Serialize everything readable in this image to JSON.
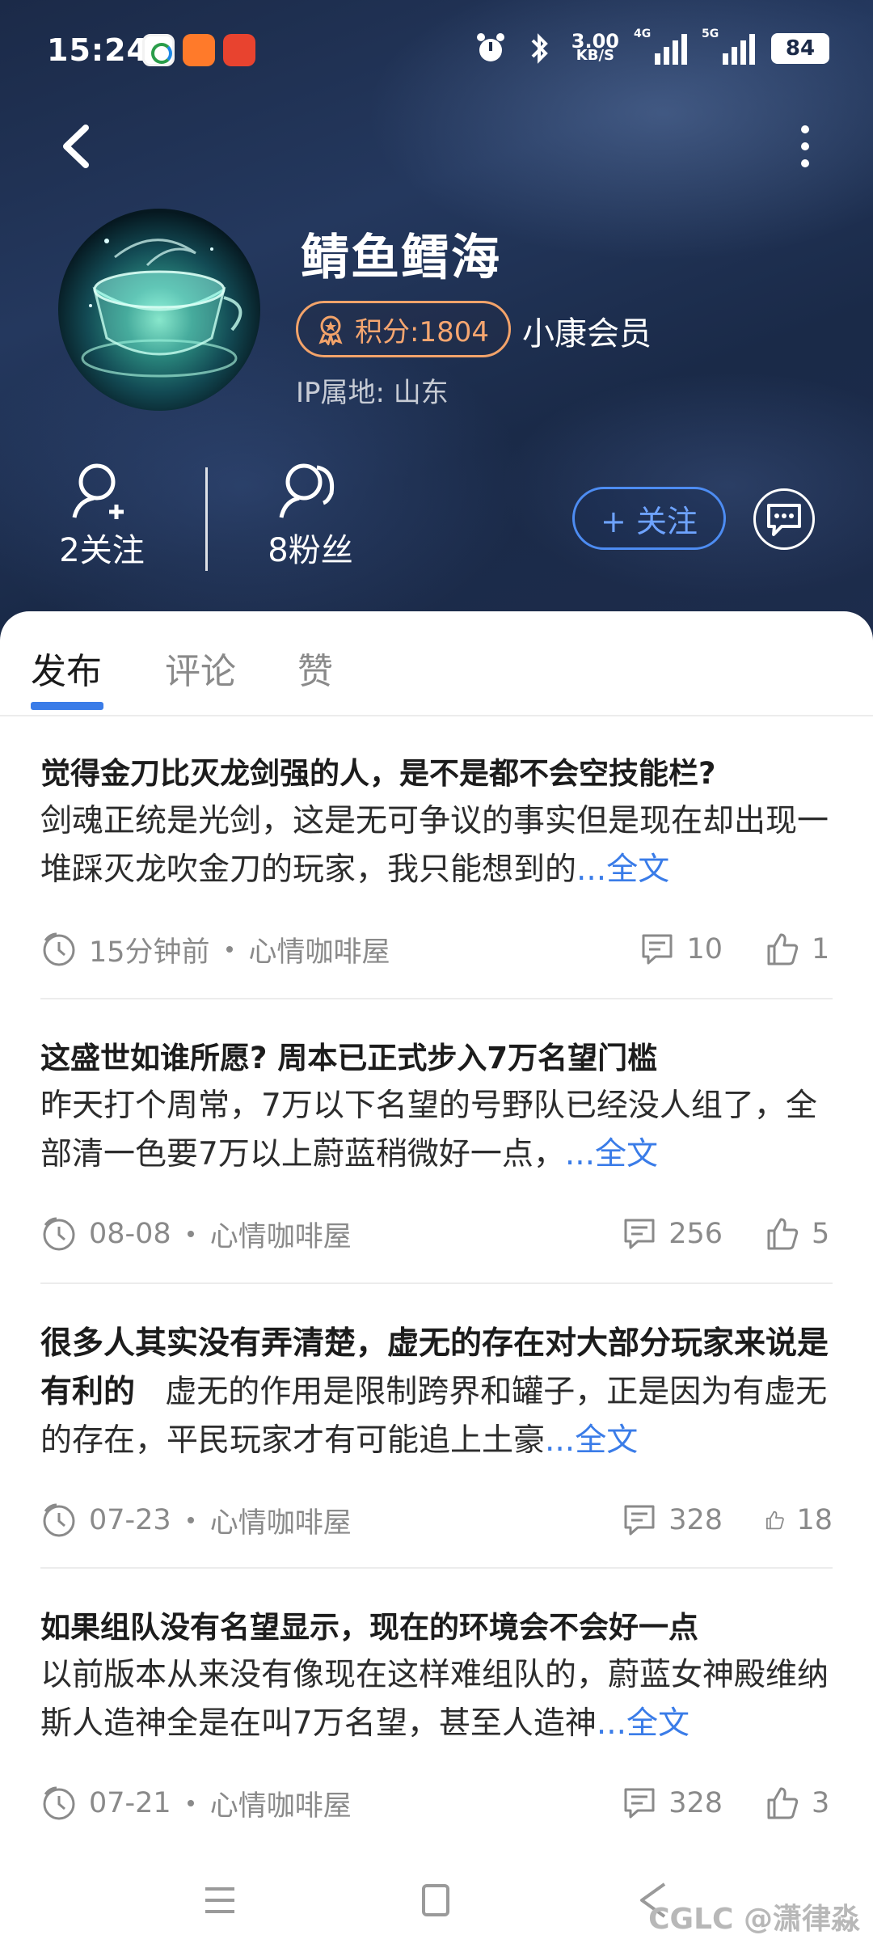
{
  "status_bar": {
    "time": "15:24",
    "net_speed_value": "3.00",
    "net_speed_unit": "KB/S",
    "signal_1": "4G",
    "signal_2": "5G",
    "battery": "84"
  },
  "profile": {
    "username": "鲭鱼鳕海",
    "points": "积分:1804",
    "member": "小康会员",
    "ip_location": "IP属地: 山东",
    "following": "2关注",
    "fans": "8粉丝",
    "follow_button": "+ 关注"
  },
  "tabs": [
    {
      "label": "发布",
      "active": true
    },
    {
      "label": "评论",
      "active": false
    },
    {
      "label": "赞",
      "active": false
    }
  ],
  "posts": [
    {
      "title": "觉得金刀比灭龙剑强的人，是不是都不会空技能栏?",
      "body": "剑魂正统是光剑，这是无可争议的事实但是现在却出现一堆踩灭龙吹金刀的玩家，我只能想到的",
      "more": "...全文",
      "time": "15分钟前",
      "channel": "心情咖啡屋",
      "comments": "10",
      "likes": "1"
    },
    {
      "title": "这盛世如谁所愿? 周本已正式步入7万名望门槛",
      "body": "昨天打个周常，7万以下名望的号野队已经没人组了，全部清一色要7万以上蔚蓝稍微好一点，",
      "more": "...全文",
      "time": "08-08",
      "channel": "心情咖啡屋",
      "comments": "256",
      "likes": "5"
    },
    {
      "title": "很多人其实没有弄清楚，虚无的存在对大部分玩家来说是有利的",
      "body": "虚无的作用是限制跨界和罐子，正是因为有虚无的存在，平民玩家才有可能追上土豪",
      "more": "...全文",
      "time": "07-23",
      "channel": "心情咖啡屋",
      "comments": "328",
      "likes": "18"
    },
    {
      "title": "如果组队没有名望显示，现在的环境会不会好一点",
      "body": "以前版本从来没有像现在这样难组队的，蔚蓝女神殿维纳斯人造神全是在叫7万名望，甚至人造神",
      "more": "...全文",
      "time": "07-21",
      "channel": "心情咖啡屋",
      "comments": "328",
      "likes": "3"
    }
  ],
  "watermark": "CGLC @潇律淼",
  "colors": {
    "accent": "#3a7ce8",
    "points": "#f3a36a",
    "hero_bg": "#1b2a48"
  }
}
